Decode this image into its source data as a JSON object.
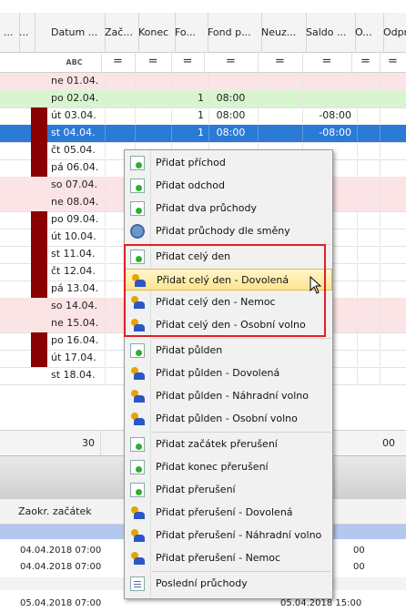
{
  "grid": {
    "headers": [
      "...",
      "...",
      "Datum ...",
      "Zač...",
      "Konec",
      "Fo...",
      "Fond p...",
      "Neuz...",
      "Saldo ...",
      "O...",
      "Odpr"
    ],
    "filter_symbol": "=",
    "filter_abc": "ABC",
    "rows": [
      {
        "date": "ne 01.04.",
        "c1": "",
        "c2": "",
        "saldo": ""
      },
      {
        "date": "po 02.04.",
        "c1": "1",
        "c2": "08:00",
        "saldo": ""
      },
      {
        "date": "út 03.04.",
        "c1": "1",
        "c2": "08:00",
        "saldo": "-08:00"
      },
      {
        "date": "st 04.04.",
        "c1": "1",
        "c2": "08:00",
        "saldo": "-08:00"
      },
      {
        "date": "čt 05.04.",
        "c1": "",
        "c2": "",
        "saldo": ""
      },
      {
        "date": "pá 06.04.",
        "c1": "",
        "c2": "",
        "saldo": ""
      },
      {
        "date": "so 07.04.",
        "c1": "",
        "c2": "",
        "saldo": ""
      },
      {
        "date": "ne 08.04.",
        "c1": "",
        "c2": "",
        "saldo": ""
      },
      {
        "date": "po 09.04.",
        "c1": "",
        "c2": "",
        "saldo": ""
      },
      {
        "date": "út 10.04.",
        "c1": "",
        "c2": "",
        "saldo": ""
      },
      {
        "date": "st 11.04.",
        "c1": "",
        "c2": "",
        "saldo": ""
      },
      {
        "date": "čt 12.04.",
        "c1": "",
        "c2": "",
        "saldo": ""
      },
      {
        "date": "pá 13.04.",
        "c1": "",
        "c2": "",
        "saldo": ""
      },
      {
        "date": "so 14.04.",
        "c1": "",
        "c2": "",
        "saldo": ""
      },
      {
        "date": "ne 15.04.",
        "c1": "",
        "c2": "",
        "saldo": ""
      },
      {
        "date": "po 16.04.",
        "c1": "",
        "c2": "",
        "saldo": ""
      },
      {
        "date": "út 17.04.",
        "c1": "",
        "c2": "",
        "saldo": ""
      },
      {
        "date": "st 18.04.",
        "c1": "",
        "c2": "",
        "saldo": ""
      }
    ],
    "summary_left": "30",
    "summary_right": "00"
  },
  "lower_panel": {
    "header": "Zaokr. začátek",
    "rows": [
      {
        "left": "04.04.2018 07:00",
        "right": "00"
      },
      {
        "left": "04.04.2018 07:00",
        "right": "00"
      },
      {
        "left": "05.04.2018 07:00",
        "right": "05.04.2018 15:00"
      }
    ]
  },
  "context_menu": {
    "items": [
      {
        "label": "Přidat příchod",
        "icon": "add-document-icon"
      },
      {
        "label": "Přidat odchod",
        "icon": "add-document-icon"
      },
      {
        "label": "Přidat dva průchody",
        "icon": "add-document-icon"
      },
      {
        "label": "Přidat průchody dle směny",
        "icon": "shift-gear-icon"
      },
      {
        "label": "Přidat celý den",
        "icon": "add-document-icon"
      },
      {
        "label": "Přidat celý den - Dovolená",
        "icon": "user-icon"
      },
      {
        "label": "Přidat celý den - Nemoc",
        "icon": "user-icon"
      },
      {
        "label": "Přidat celý den - Osobní volno",
        "icon": "user-icon"
      },
      {
        "label": "Přidat půlden",
        "icon": "add-document-icon"
      },
      {
        "label": "Přidat půlden - Dovolená",
        "icon": "user-icon"
      },
      {
        "label": "Přidat půlden - Náhradní volno",
        "icon": "user-icon"
      },
      {
        "label": "Přidat půlden - Osobní volno",
        "icon": "user-icon"
      },
      {
        "label": "Přidat začátek přerušení",
        "icon": "add-document-icon"
      },
      {
        "label": "Přidat konec přerušení",
        "icon": "add-document-icon"
      },
      {
        "label": "Přidat přerušení",
        "icon": "add-document-icon"
      },
      {
        "label": "Přidat přerušení - Dovolená",
        "icon": "user-icon"
      },
      {
        "label": "Přidat přerušení - Náhradní volno",
        "icon": "user-icon"
      },
      {
        "label": "Přidat přerušení - Nemoc",
        "icon": "user-icon"
      },
      {
        "label": "Poslední průchody",
        "icon": "list-document-icon"
      }
    ],
    "highlighted_index": 5
  },
  "colors": {
    "weekend_row": "#fbe4e6",
    "today_row": "#d8f5d0",
    "selected_row": "#2a7ad6",
    "annotation_box": "#e01f26",
    "absence_marker": "#8b0000"
  }
}
